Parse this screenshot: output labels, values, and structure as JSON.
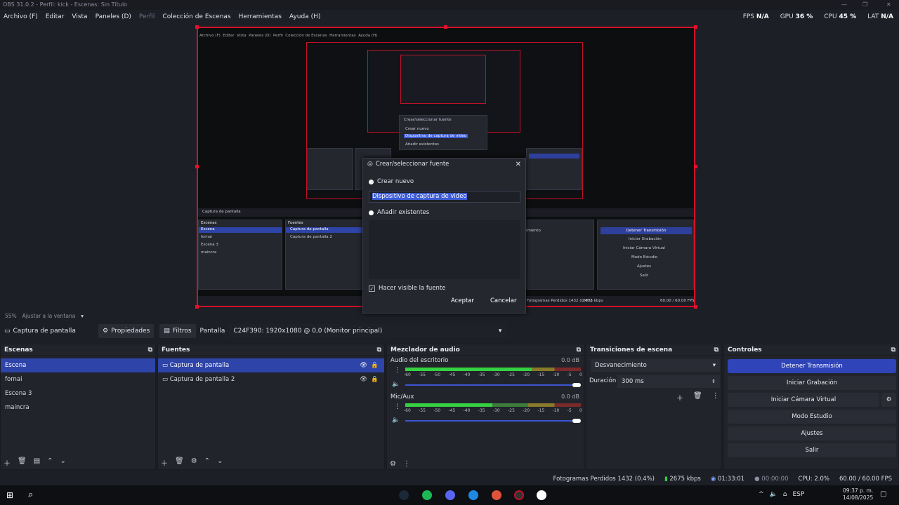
{
  "window": {
    "title": "OBS 31.0.2 - Perfil: kick - Escenas: Sin Título"
  },
  "menu": [
    "Archivo (F)",
    "Editar",
    "Vista",
    "Paneles (D)",
    "Perfil",
    "Colección de Escenas",
    "Herramientas",
    "Ayuda (H)"
  ],
  "stats": {
    "fps_label": "FPS",
    "fps": "N/A",
    "gpu_label": "GPU",
    "gpu": "36 %",
    "cpu_label": "CPU",
    "cpu": "45 %",
    "lat_label": "LAT",
    "lat": "N/A"
  },
  "dialog": {
    "title": "Crear/seleccionar fuente",
    "create_new": "Crear nuevo",
    "name_value": "Dispositivo de captura de video",
    "add_existing": "Añadir existentes",
    "visible_label": "Hacer visible la fuente",
    "accept": "Aceptar",
    "cancel": "Cancelar"
  },
  "zoombar": {
    "zoom": "55%",
    "fit": "Ajustar a la ventana"
  },
  "sourcebar": {
    "source": "Captura de pantalla",
    "properties": "Propiedades",
    "filters": "Filtros",
    "display_label": "Pantalla",
    "display_value": "C24F390: 1920x1080 @ 0,0 (Monitor principal)"
  },
  "scenes": {
    "title": "Escenas",
    "items": [
      "Escena",
      "fornai",
      "Escena 3",
      "maincra"
    ]
  },
  "sources": {
    "title": "Fuentes",
    "items": [
      "Captura de pantalla",
      "Captura de pantalla 2"
    ]
  },
  "mixer": {
    "title": "Mezclador de audio",
    "channels": [
      {
        "name": "Audio del escritorio",
        "db": "0.0 dB"
      },
      {
        "name": "Mic/Aux",
        "db": "0.0 dB"
      }
    ],
    "ticks": [
      "-60",
      "-55",
      "-50",
      "-45",
      "-40",
      "-35",
      "-30",
      "-25",
      "-20",
      "-15",
      "-10",
      "-5",
      "0"
    ]
  },
  "transitions": {
    "title": "Transiciones de escena",
    "type": "Desvanecimiento",
    "duration_label": "Duración",
    "duration": "300 ms"
  },
  "controls": {
    "title": "Controles",
    "buttons": [
      "Detener Transmisión",
      "Iniciar Grabación",
      "Iniciar Cámara Virtual",
      "Modo Estudio",
      "Ajustes",
      "Salir"
    ]
  },
  "status": {
    "dropped": "Fotogramas Perdidos 1432 (0.4%)",
    "bitrate": "2675 kbps",
    "live_time": "01:33:01",
    "rec_time": "00:00:00",
    "cpu": "CPU: 2.0%",
    "fps": "60.00 / 60.00 FPS"
  },
  "taskbar": {
    "lang": "ESP",
    "time": "09:37 p. m.",
    "date": "14/08/2025"
  },
  "nested": {
    "menu": [
      "Archivo (F)",
      "Editar",
      "Vista",
      "Paneles (D)",
      "Perfil",
      "Colección de Escenas",
      "Herramientas",
      "Ayuda (H)"
    ],
    "sources": [
      "Captura de pantalla",
      "Captura de pantalla 2"
    ],
    "scenes": [
      "Escena",
      "fornai",
      "Escena 3",
      "maincra"
    ],
    "controls": [
      "Detener Transmisión",
      "Iniciar Grabación",
      "Iniciar Cámara Virtual",
      "Modo Estudio",
      "Ajustes",
      "Salir"
    ],
    "transition": "Desvanecimiento",
    "status": "Fotogramas Perdidos 1432 (0.4%)",
    "kbps": "2675 kbps",
    "fps": "60.00 / 60.00 FPS",
    "dialog_title": "Crear/seleccionar fuente",
    "dialog_create": "Crear nuevo",
    "dialog_name": "Dispositivo de captura de video",
    "dialog_existing": "Añadir existentes"
  },
  "colors": {
    "accent": "#2e44b8",
    "selection": "#d0102a",
    "meter_green": "#36d043"
  }
}
